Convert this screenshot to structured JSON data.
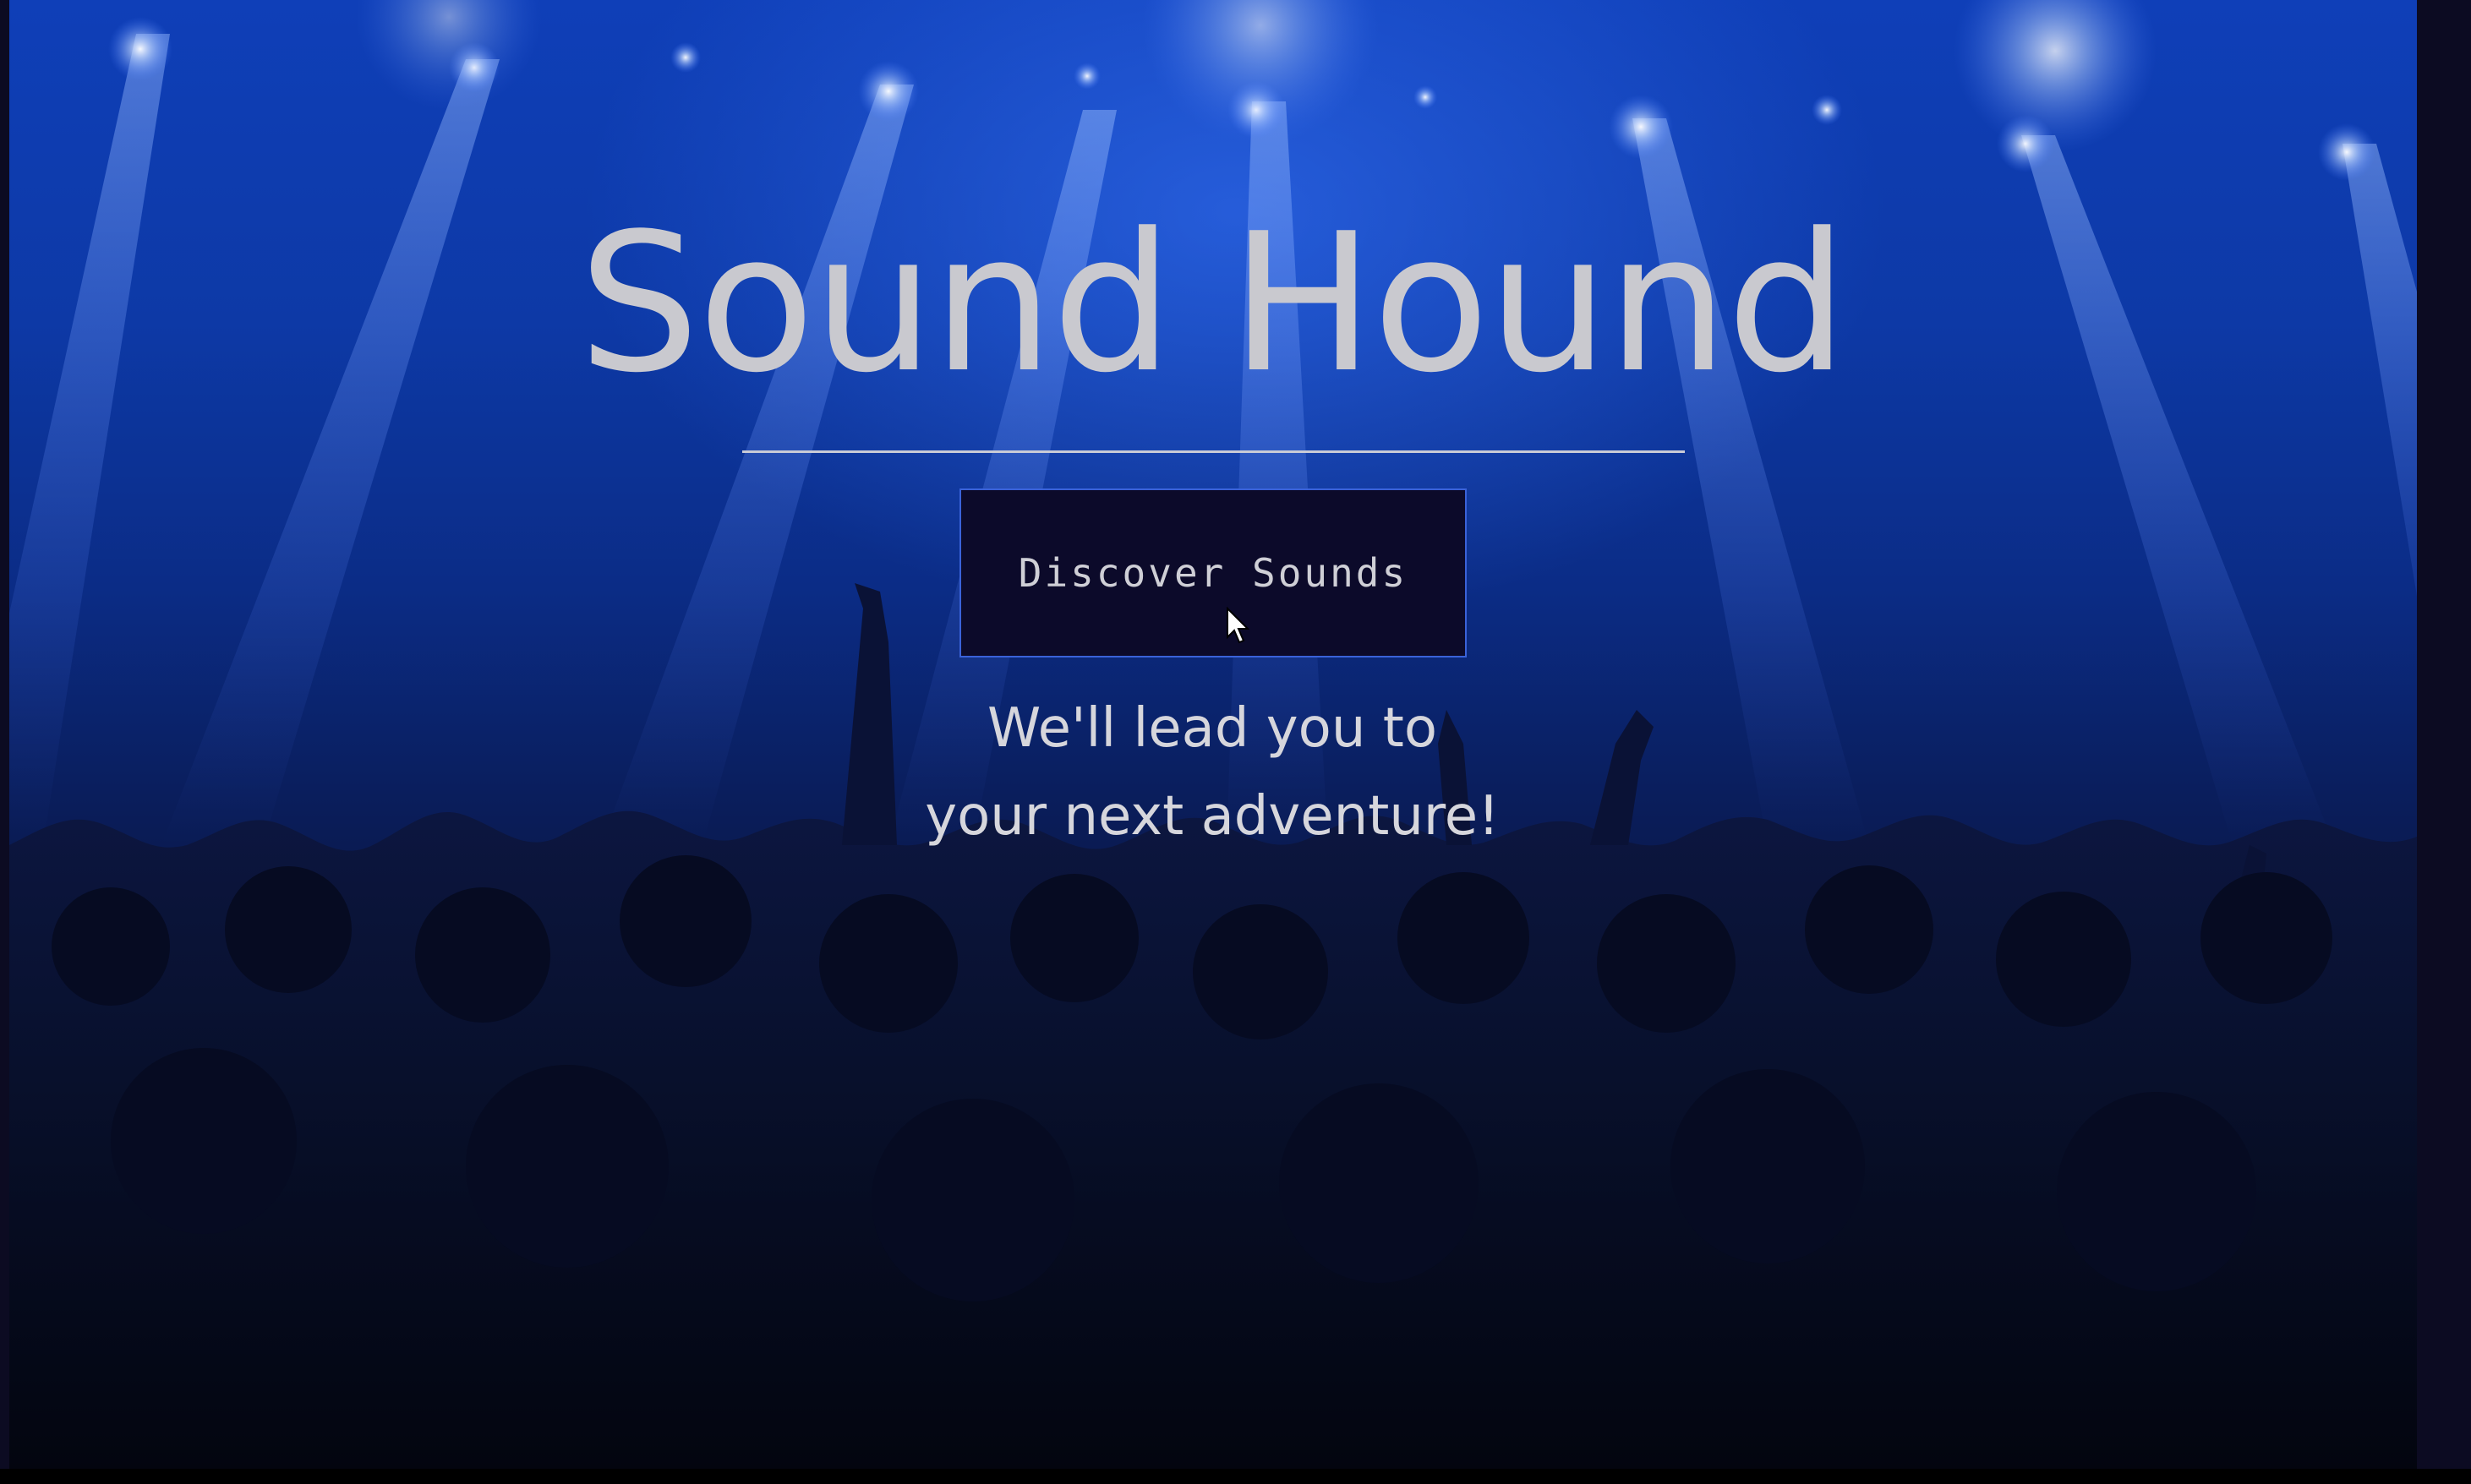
{
  "hero": {
    "title": "Sound Hound",
    "button_label": "Discover Sounds",
    "tagline_line1": "We'll lead you to",
    "tagline_line2": "your next adventure!",
    "background_icon": "concert-crowd-image"
  },
  "colors": {
    "background_top": "#0f3fb8",
    "background_bottom": "#070a1e",
    "title_text": "#c9c9cf",
    "button_bg": "#0c0a2a",
    "button_border": "#3a62d8"
  }
}
